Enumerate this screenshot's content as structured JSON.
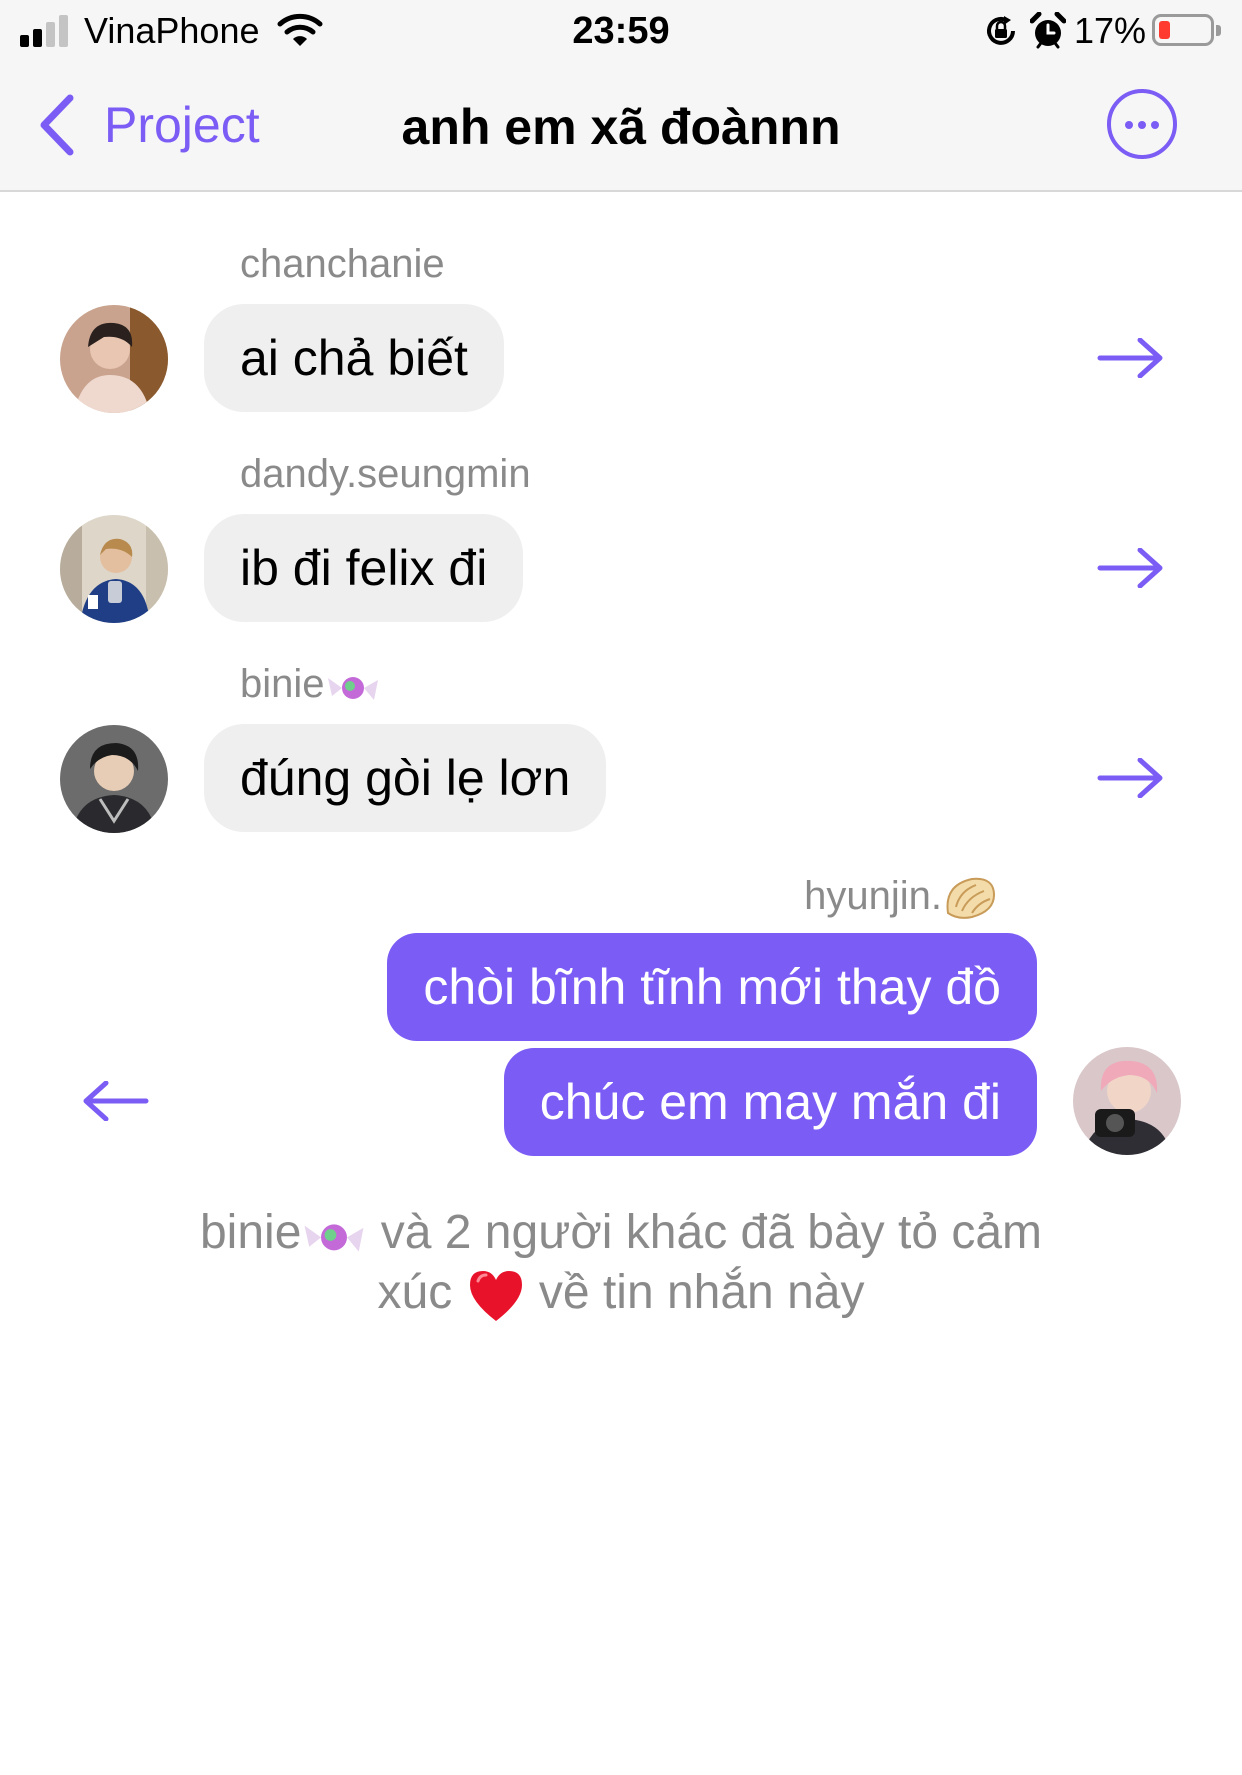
{
  "status_bar": {
    "carrier": "VinaPhone",
    "time": "23:59",
    "battery_percent": "17%",
    "battery_level": 0.17,
    "icons": [
      "signal-icon",
      "wifi-icon",
      "orientation-lock-icon",
      "alarm-icon",
      "battery-icon"
    ]
  },
  "nav": {
    "back_label": "Project",
    "title": "anh em xã đoànnn",
    "more_icon": "more-options-icon"
  },
  "messages": [
    {
      "sender": "chanchanie",
      "text": "ai chả biết",
      "direction": "incoming"
    },
    {
      "sender": "dandy.seungmin",
      "text": "ib đi felix đi",
      "direction": "incoming"
    },
    {
      "sender": "binie",
      "sender_emoji": "candy-icon",
      "text": "đúng gòi lẹ lơn",
      "direction": "incoming"
    },
    {
      "sender": "hyunjin.",
      "sender_emoji": "dumpling-icon",
      "direction": "outgoing",
      "texts": [
        "chòi bĩnh tĩnh mới thay đồ",
        "chúc em may mắn đi"
      ]
    }
  ],
  "reaction_summary": {
    "name": "binie",
    "line1_rest": "và 2 người khác đã bày tỏ cảm",
    "line2_start": "xúc",
    "reaction": "heart",
    "line2_end": "về tin nhắn này"
  },
  "colors": {
    "accent": "#7b5cf5",
    "incoming_bubble": "#efefef",
    "muted_text": "#8a8a8a",
    "battery_low": "#ff3b30"
  }
}
